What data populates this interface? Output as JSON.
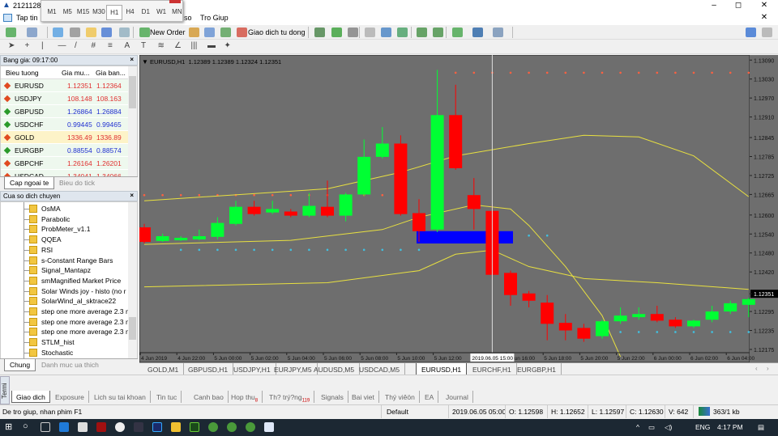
{
  "window": {
    "title": "21211282:",
    "controls": [
      "–",
      "◻",
      "✕"
    ]
  },
  "timeframes": {
    "items": [
      "M1",
      "M5",
      "M15",
      "M30",
      "H1",
      "H4",
      "D1",
      "W1",
      "MN"
    ],
    "selected": "H1"
  },
  "menu": [
    "Tap tin",
    "Xem",
    "Them",
    "Bieu do",
    "Cong Cu",
    "Cua so",
    "Tro Giup"
  ],
  "toolbar": {
    "new_order": "New Order",
    "auto_trading": "Giao dich tu dong"
  },
  "market_watch": {
    "title": "Bang gia: 09:17:00",
    "columns": [
      "Bieu tuong",
      "Gia mu...",
      "Gia ban..."
    ],
    "rows": [
      {
        "symbol": "EURUSD",
        "bid": "1.12351",
        "ask": "1.12364",
        "dir": "down",
        "color": "#e03030"
      },
      {
        "symbol": "USDJPY",
        "bid": "108.148",
        "ask": "108.163",
        "dir": "down",
        "color": "#e03030"
      },
      {
        "symbol": "GBPUSD",
        "bid": "1.26864",
        "ask": "1.26884",
        "dir": "up",
        "color": "#2030d0"
      },
      {
        "symbol": "USDCHF",
        "bid": "0.99445",
        "ask": "0.99465",
        "dir": "up",
        "color": "#2030d0"
      },
      {
        "symbol": "GOLD",
        "bid": "1336.49",
        "ask": "1336.89",
        "dir": "down",
        "color": "#e03030",
        "highlight": true
      },
      {
        "symbol": "EURGBP",
        "bid": "0.88554",
        "ask": "0.88574",
        "dir": "up",
        "color": "#2030d0"
      },
      {
        "symbol": "GBPCHF",
        "bid": "1.26164",
        "ask": "1.26201",
        "dir": "down",
        "color": "#e03030"
      },
      {
        "symbol": "USDCAD",
        "bid": "1.34041",
        "ask": "1.34066",
        "dir": "down",
        "color": "#e03030"
      },
      {
        "symbol": "EURCHF",
        "bid": "1.11745",
        "ask": "1.11768",
        "dir": "up",
        "color": "#2030d0"
      }
    ],
    "tabs": [
      "Cap ngoai te",
      "Bieu do tick"
    ]
  },
  "navigator": {
    "title": "Cua so dich chuyen",
    "items": [
      "OsMA",
      "Parabolic",
      "ProbMeter_v1.1",
      "QQEA",
      "RSI",
      "s-Constant Range Bars",
      "Signal_Mantapz",
      "smMagnified Market Price",
      "Solar Winds joy - histo (no r",
      "SolarWind_al_sktrace22",
      "step one more average 2.3 n",
      "step one more average 2.3 n",
      "step one more average 2.3 n",
      "STLM_hist",
      "Stochastic",
      "Stoops System ALL IN ONE"
    ],
    "tabs": [
      "Chung",
      "Danh muc ua thich"
    ]
  },
  "chart_data": {
    "type": "candlestick",
    "header": "EURUSD,H1  1.12389 1.12389 1.12324 1.12351",
    "ylim": [
      1.12134,
      1.13106
    ],
    "y_ticks": [
      "1.13090",
      "1.13030",
      "1.12970",
      "1.12910",
      "1.12845",
      "1.12785",
      "1.12725",
      "1.12665",
      "1.12600",
      "1.12540",
      "1.12480",
      "1.12420",
      "1.12351",
      "1.12295",
      "1.12235",
      "1.12175"
    ],
    "current_price": "1.12351",
    "x_labels": [
      "4 Jun 2019",
      "4 Jun 22:00",
      "5 Jun 00:00",
      "5 Jun 02:00",
      "5 Jun 04:00",
      "5 Jun 06:00",
      "5 Jun 08:00",
      "5 Jun 10:00",
      "5 Jun 12:00",
      "",
      "5 Jun 16:00",
      "5 Jun 18:00",
      "5 Jun 20:00",
      "5 Jun 22:00",
      "6 Jun 00:00",
      "6 Jun 02:00",
      "6 Jun 04:00"
    ],
    "crosshair_label": "2019.06.05 15:00",
    "crosshair_bar": 19,
    "colors": {
      "bull": "#00ff33",
      "bear": "#ff0000",
      "background": "#6e6e6e",
      "band": "#e8e040",
      "box": "#0000ff",
      "dot_up": "#ff6040",
      "dot_dn": "#40c0e0"
    },
    "ohlc": [
      [
        1.12561,
        1.12572,
        1.1251,
        1.12515
      ],
      [
        1.12518,
        1.12541,
        1.12515,
        1.12533
      ],
      [
        1.1252,
        1.12533,
        1.12518,
        1.12528
      ],
      [
        1.12523,
        1.12554,
        1.1252,
        1.12533
      ],
      [
        1.12531,
        1.12593,
        1.12523,
        1.12575
      ],
      [
        1.12572,
        1.12645,
        1.12567,
        1.12626
      ],
      [
        1.12626,
        1.12645,
        1.12598,
        1.12603
      ],
      [
        1.12608,
        1.12645,
        1.12603,
        1.12619
      ],
      [
        1.12611,
        1.12619,
        1.12593,
        1.12598
      ],
      [
        1.12598,
        1.1267,
        1.12593,
        1.12629
      ],
      [
        1.12626,
        1.12709,
        1.12593,
        1.12598
      ],
      [
        1.12598,
        1.1267,
        1.1258,
        1.12665
      ],
      [
        1.12665,
        1.12839,
        1.1266,
        1.12784
      ],
      [
        1.12784,
        1.12878,
        1.12779,
        1.12826
      ],
      [
        1.12826,
        1.12852,
        1.12598,
        1.12603
      ],
      [
        1.12606,
        1.1265,
        1.12515,
        1.12549
      ],
      [
        1.12554,
        1.13059,
        1.12546,
        1.12916
      ],
      [
        1.12916,
        1.13012,
        1.12743,
        1.12748
      ],
      [
        1.12663,
        1.12717,
        1.12554,
        1.12619
      ],
      [
        1.12613,
        1.12632,
        1.12399,
        1.12411
      ],
      [
        1.12417,
        1.12424,
        1.12313,
        1.12347
      ],
      [
        1.12352,
        1.1236,
        1.12308,
        1.12329
      ],
      [
        1.12323,
        1.12347,
        1.12204,
        1.12256
      ],
      [
        1.12259,
        1.12287,
        1.12204,
        1.12235
      ],
      [
        1.12243,
        1.12256,
        1.12199,
        1.12209
      ],
      [
        1.12217,
        1.12269,
        1.12209,
        1.12264
      ],
      [
        1.12264,
        1.12308,
        1.12256,
        1.12282
      ],
      [
        1.12277,
        1.12308,
        1.12269,
        1.12287
      ],
      [
        1.12287,
        1.12313,
        1.12261,
        1.12266
      ],
      [
        1.12269,
        1.12277,
        1.12243,
        1.12248
      ],
      [
        1.12248,
        1.12269,
        1.12243,
        1.12266
      ],
      [
        1.12269,
        1.12313,
        1.12261,
        1.12295
      ],
      [
        1.12295,
        1.12329,
        1.12287,
        1.12321
      ],
      [
        1.12316,
        1.12339,
        1.12277,
        1.12334
      ]
    ],
    "bands": [
      [
        [
          0,
          1.12645
        ],
        [
          10,
          1.12683
        ],
        [
          14,
          1.12735
        ],
        [
          17,
          1.12787
        ],
        [
          21,
          1.12826
        ],
        [
          24,
          1.12852
        ],
        [
          27,
          1.12847
        ],
        [
          30,
          1.12787
        ],
        [
          33,
          1.12658
        ]
      ],
      [
        [
          0,
          1.12507
        ],
        [
          8,
          1.1252
        ],
        [
          13,
          1.12554
        ],
        [
          15,
          1.12593
        ],
        [
          18,
          1.12632
        ],
        [
          20,
          1.12619
        ],
        [
          21,
          1.12567
        ],
        [
          23,
          1.12437
        ],
        [
          25,
          1.12282
        ],
        [
          26,
          1.12152
        ]
      ],
      [
        [
          0,
          1.12373
        ],
        [
          10,
          1.12386
        ],
        [
          15,
          1.12424
        ],
        [
          17,
          1.12476
        ],
        [
          19,
          1.12489
        ],
        [
          21,
          1.12437
        ],
        [
          24,
          1.12399
        ],
        [
          28,
          1.12386
        ],
        [
          33,
          1.12365
        ]
      ]
    ],
    "box": {
      "from_bar": 15,
      "to_bar": 20,
      "top": 1.12549,
      "bottom": 1.1251
    },
    "dots": [
      {
        "price": 1.1305,
        "from": 17,
        "to": 33,
        "kind": "up"
      },
      {
        "price": 1.12663,
        "from": 0,
        "to": 14,
        "kind": "up"
      },
      {
        "price": 1.1249,
        "from": 2,
        "to": 15,
        "kind": "dn"
      },
      {
        "price": 1.12535,
        "from": 20,
        "to": 22,
        "kind": "dn"
      },
      {
        "price": 1.1223,
        "from": 24,
        "to": 33,
        "kind": "dn"
      }
    ]
  },
  "chart_tabs": {
    "items": [
      "GOLD,M1",
      "GBPUSD,H1",
      "USDJPY,H1",
      "EURJPY,M5",
      "AUDUSD,M5",
      "USDCAD,M5",
      "EURUSD,H1",
      "EURCHF,H1",
      "EURGBP,H1"
    ],
    "active": "EURUSD,H1"
  },
  "terminal": {
    "side_label": "Termi",
    "tabs": [
      {
        "label": "Giao dich"
      },
      {
        "label": "Exposure"
      },
      {
        "label": "Lich su tai khoan"
      },
      {
        "label": "Tin tuc"
      },
      {
        "label": "Canh bao"
      },
      {
        "label": "Hop thu",
        "badge": "8"
      },
      {
        "label": "Th? trý?ng",
        "badge": "119"
      },
      {
        "label": "Signals"
      },
      {
        "label": "Bai viet"
      },
      {
        "label": "Thý viêön"
      },
      {
        "label": "EA"
      },
      {
        "label": "Journal"
      }
    ]
  },
  "status": {
    "help": "De tro giup, nhan phim F1",
    "profile": "Default",
    "time": "2019.06.05 05:00",
    "open": "O: 1.12598",
    "high": "H: 1.12652",
    "low": "L: 1.12597",
    "close": "C: 1.12630",
    "volume": "V: 642",
    "traffic": "363/1 kb"
  },
  "taskbar": {
    "lang": "ENG",
    "clock": "4:17 PM"
  }
}
